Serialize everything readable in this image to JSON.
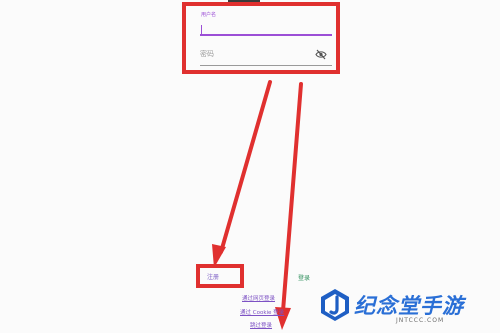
{
  "form": {
    "username_label": "用户名",
    "password_placeholder": "密码",
    "register_label": "注册",
    "login_label": "登录",
    "links": [
      "通过网页登录",
      "通过 Cookie 登录",
      "跳过登录"
    ]
  },
  "watermark": {
    "title": "纪念堂手游",
    "url": "JNTCCC.COM"
  },
  "colors": {
    "accent": "#9c4fd6",
    "annotation_red": "#e0302f",
    "login_green": "#2f8f5c",
    "watermark_blue": "#2a6fd6"
  },
  "icons": {
    "password_toggle": "eye-slash-icon"
  }
}
